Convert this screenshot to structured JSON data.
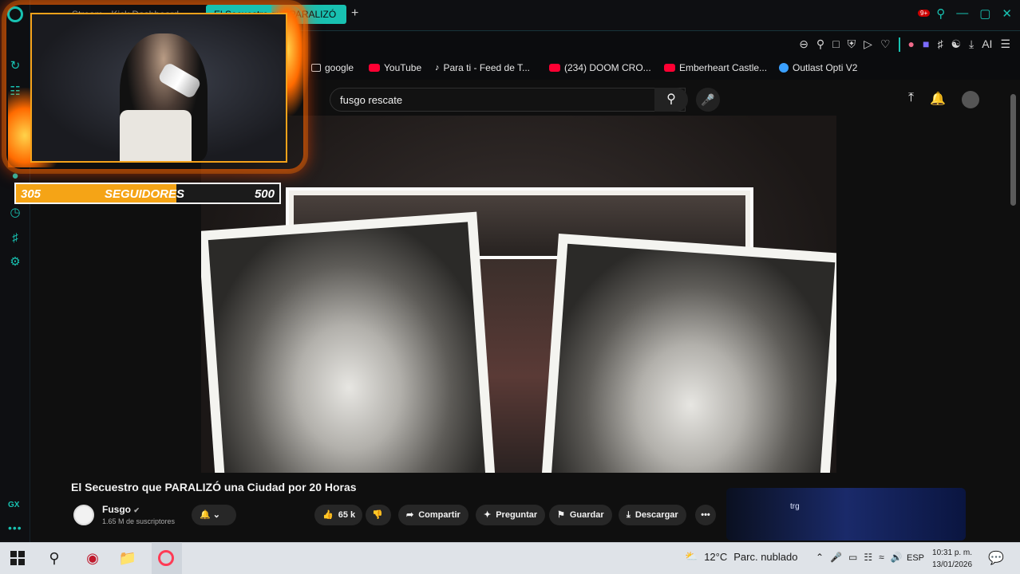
{
  "browser": {
    "tabs": [
      {
        "label": "Stream - Kick Dashboard"
      },
      {
        "label": "El Secuestro que PARALIZÓ"
      }
    ],
    "new_tab": "+",
    "window_controls": [
      "search",
      "minimize",
      "maximize",
      "close"
    ],
    "accent": "#18c1b1",
    "bookmarks": [
      {
        "label": "google",
        "icon": "folder-icon"
      },
      {
        "label": "YouTube",
        "icon": "youtube-icon"
      },
      {
        "label": "Para ti - Feed de T...",
        "icon": "tiktok-icon"
      },
      {
        "label": "(234) DOOM CRO...",
        "icon": "youtube-icon"
      },
      {
        "label": "Emberheart Castle...",
        "icon": "youtube-icon"
      },
      {
        "label": "Outlast Opti V2",
        "icon": "outlast-icon"
      }
    ],
    "toolbar_ai": "AI"
  },
  "sidebar": {
    "gx_label": "GX",
    "more": "•••"
  },
  "youtube": {
    "search_value": "fusgo rescate",
    "notification_count": "9+",
    "video": {
      "title": "El Secuestro que PARALIZÓ una Ciudad por 20 Horas",
      "channel": "Fusgo",
      "subscribers": "1.65 M de suscriptores",
      "likes": "65 k",
      "share": "Compartir",
      "ask": "Preguntar",
      "save": "Guardar",
      "download": "Descargar",
      "more": "•••"
    },
    "ad_text": "trg"
  },
  "overlay": {
    "followers_current": "305",
    "followers_label": "SEGUIDORES",
    "followers_goal": "500",
    "progress_fraction": 0.61,
    "bar_color": "#f5a416"
  },
  "taskbar": {
    "weather_temp": "12°C",
    "weather_desc": "Parc. nublado",
    "language": "ESP",
    "time": "10:31 p. m.",
    "date": "13/01/2026"
  }
}
